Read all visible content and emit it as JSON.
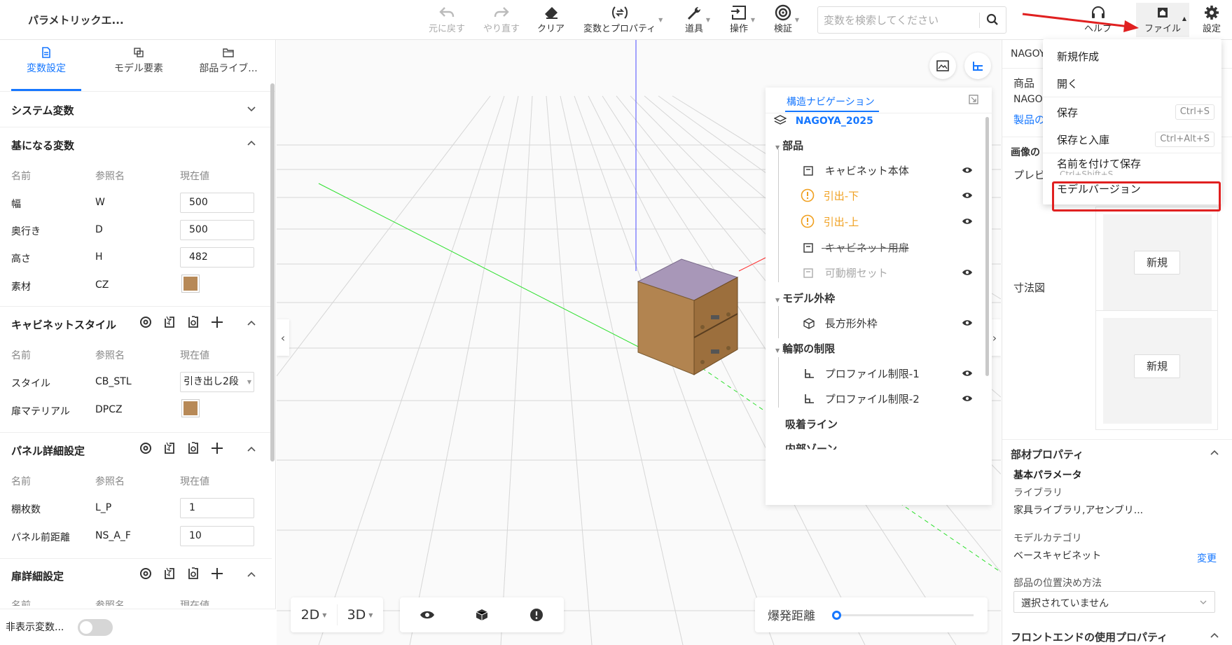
{
  "app": {
    "title": "パラメトリックエ..."
  },
  "toolbar": {
    "undo": "元に戻す",
    "redo": "やり直す",
    "clear": "クリア",
    "variables": "変数とプロパティ",
    "tools": "道具",
    "operation": "操作",
    "verify": "検証",
    "search_placeholder": "変数を検索してください",
    "help": "ヘルプ",
    "file": "ファイル",
    "settings": "設定"
  },
  "left_panel": {
    "tabs": [
      {
        "label": "変数設定"
      },
      {
        "label": "モデル要素"
      },
      {
        "label": "部品ライブ..."
      }
    ],
    "system_vars_title": "システム変数",
    "col_name": "名前",
    "col_ref": "参照名",
    "col_value": "現在値",
    "base_vars": {
      "title": "基になる変数",
      "rows": [
        {
          "name": "幅",
          "ref": "W",
          "value": "500"
        },
        {
          "name": "奥行き",
          "ref": "D",
          "value": "500"
        },
        {
          "name": "高さ",
          "ref": "H",
          "value": "482"
        },
        {
          "name": "素材",
          "ref": "CZ"
        }
      ]
    },
    "cabinet_style": {
      "title": "キャビネットスタイル",
      "rows": [
        {
          "name": "スタイル",
          "ref": "CB_STL",
          "value": "引き出し2段"
        },
        {
          "name": "扉マテリアル",
          "ref": "DPCZ"
        }
      ]
    },
    "panel_detail": {
      "title": "パネル詳細設定",
      "rows": [
        {
          "name": "棚枚数",
          "ref": "L_P",
          "value": "1"
        },
        {
          "name": "パネル前距離",
          "ref": "NS_A_F",
          "value": "10"
        }
      ]
    },
    "door_detail": {
      "title": "扉詳細設定"
    },
    "hidden_vars": "非表示変数..."
  },
  "viewport": {
    "btn_2d": "2D",
    "btn_3d": "3D",
    "explode_label": "爆発距離",
    "explode_value": 0
  },
  "structure_nav": {
    "tab": "構造ナビゲーション",
    "root": "NAGOYA_2025",
    "parts_group": "部品",
    "parts": [
      {
        "label": "キャビネット本体"
      },
      {
        "label": "引出-下"
      },
      {
        "label": "引出-上"
      },
      {
        "label": "キャビネット用扉"
      },
      {
        "label": "可動棚セット"
      }
    ],
    "outline_group": "モデル外枠",
    "outline_item": "長方形外枠",
    "contour_group": "輪郭の制限",
    "contour_items": [
      "プロファイル制限-1",
      "プロファイル制限-2"
    ],
    "snap_lines": "吸着ライン",
    "inner_zone": "内部ゾーン"
  },
  "right_panel": {
    "name_truncated": "NAGOY",
    "product_label": "商品",
    "product_value": "NAGO",
    "product_link": "製品の",
    "image_section": "画像の",
    "preview_label": "プレビ",
    "dimension_label": "寸法図",
    "new_btn": "新規",
    "part_props_title": "部材プロパティ",
    "basic_params": "基本パラメータ",
    "library_label": "ライブラリ",
    "library_value": "家具ライブラリ,アセンブリ...",
    "category_label": "モデルカテゴリ",
    "category_value": "ベースキャビネット",
    "change_link": "変更",
    "position_label": "部品の位置決め方法",
    "position_value": "選択されていません",
    "frontend_title": "フロントエンドの使用プロパティ"
  },
  "file_menu": {
    "items": [
      {
        "label": "新規作成"
      },
      {
        "label": "開く"
      },
      {
        "label": "保存",
        "shortcut": "Ctrl+S"
      },
      {
        "label": "保存と入庫",
        "shortcut": "Ctrl+Alt+S"
      },
      {
        "label": "名前を付けて保存",
        "shortcut": "Ctrl+Shift+S"
      },
      {
        "label": "モデルバージョン"
      }
    ]
  },
  "colors": {
    "accent": "#1677ff",
    "warning": "#f0a020",
    "highlight": "#e02020",
    "wood": "#b78957"
  }
}
